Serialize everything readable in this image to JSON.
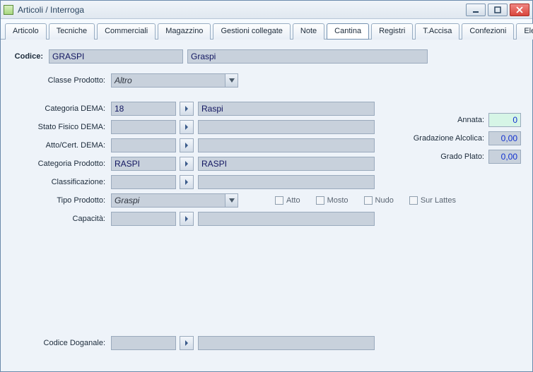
{
  "window": {
    "title": "Articoli / Interroga"
  },
  "tabs": [
    "Articolo",
    "Tecniche",
    "Commerciali",
    "Magazzino",
    "Gestioni collegate",
    "Note",
    "Cantina",
    "Registri",
    "T.Accisa",
    "Confezioni",
    "Elenco"
  ],
  "active_tab": "Cantina",
  "labels": {
    "codice": "Codice:",
    "classe_prodotto": "Classe Prodotto:",
    "categoria_dema": "Categoria DEMA:",
    "stato_fisico_dema": "Stato Fisico DEMA:",
    "atto_cert_dema": "Atto/Cert. DEMA:",
    "categoria_prodotto": "Categoria Prodotto:",
    "classificazione": "Classificazione:",
    "tipo_prodotto": "Tipo Prodotto:",
    "capacita": "Capacità:",
    "codice_doganale": "Codice Doganale:",
    "annata": "Annata:",
    "gradazione_alcolica": "Gradazione Alcolica:",
    "grado_plato": "Grado Plato:"
  },
  "checkboxes": {
    "atto": "Atto",
    "mosto": "Mosto",
    "nudo": "Nudo",
    "sur_lattes": "Sur Lattes"
  },
  "values": {
    "codice": "GRASPI",
    "codice_desc": "Graspi",
    "classe_prodotto": "Altro",
    "categoria_dema": "18",
    "categoria_dema_desc": "Raspi",
    "stato_fisico_dema": "",
    "stato_fisico_dema_desc": "",
    "atto_cert_dema": "",
    "atto_cert_dema_desc": "",
    "categoria_prodotto": "RASPI",
    "categoria_prodotto_desc": "RASPI",
    "classificazione": "",
    "classificazione_desc": "",
    "tipo_prodotto": "Graspi",
    "capacita": "",
    "capacita_desc": "",
    "codice_doganale": "",
    "codice_doganale_desc": "",
    "annata": "0",
    "gradazione_alcolica": "0,00",
    "grado_plato": "0,00"
  }
}
